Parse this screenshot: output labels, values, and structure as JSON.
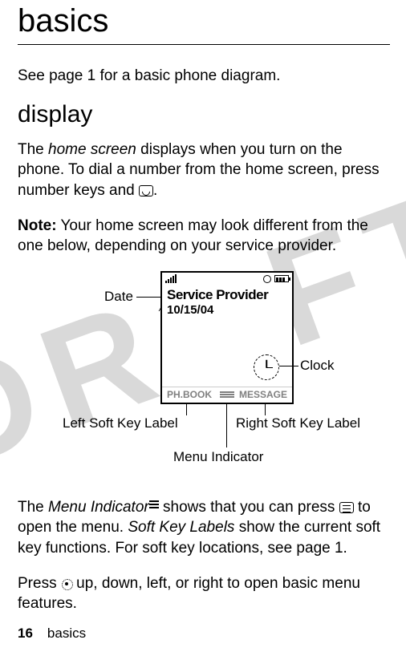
{
  "page": {
    "title": "basics",
    "intro": "See page 1 for a basic phone diagram.",
    "section_heading": "display",
    "para1_a": "The ",
    "para1_home_screen": "home screen",
    "para1_b": " displays when you turn on the phone. To dial a number from the home screen, press number keys and ",
    "para1_c": ".",
    "note_label": "Note:",
    "note_text": " Your home screen may look different from the one below, depending on your service provider.",
    "para2_a": "The ",
    "para2_mi": "Menu Indicator",
    "para2_b": " shows that you can press ",
    "para2_c": " to open the menu. ",
    "para2_skl": "Soft Key Labels",
    "para2_d": " show the current soft key functions. For soft key locations, see page 1.",
    "para3_a": "Press ",
    "para3_b": " up, down, left, or right to open basic menu features.",
    "footer_page": "16",
    "footer_section": "basics"
  },
  "diagram": {
    "provider": "Service Provider",
    "date": "10/15/04",
    "left_soft": "PH.BOOK",
    "right_soft": "MESSAGE",
    "callout_date": "Date",
    "callout_clock": "Clock",
    "callout_left": "Left Soft Key Label",
    "callout_right": "Right Soft Key Label",
    "callout_menu": "Menu Indicator"
  },
  "watermark": "DRAFT"
}
